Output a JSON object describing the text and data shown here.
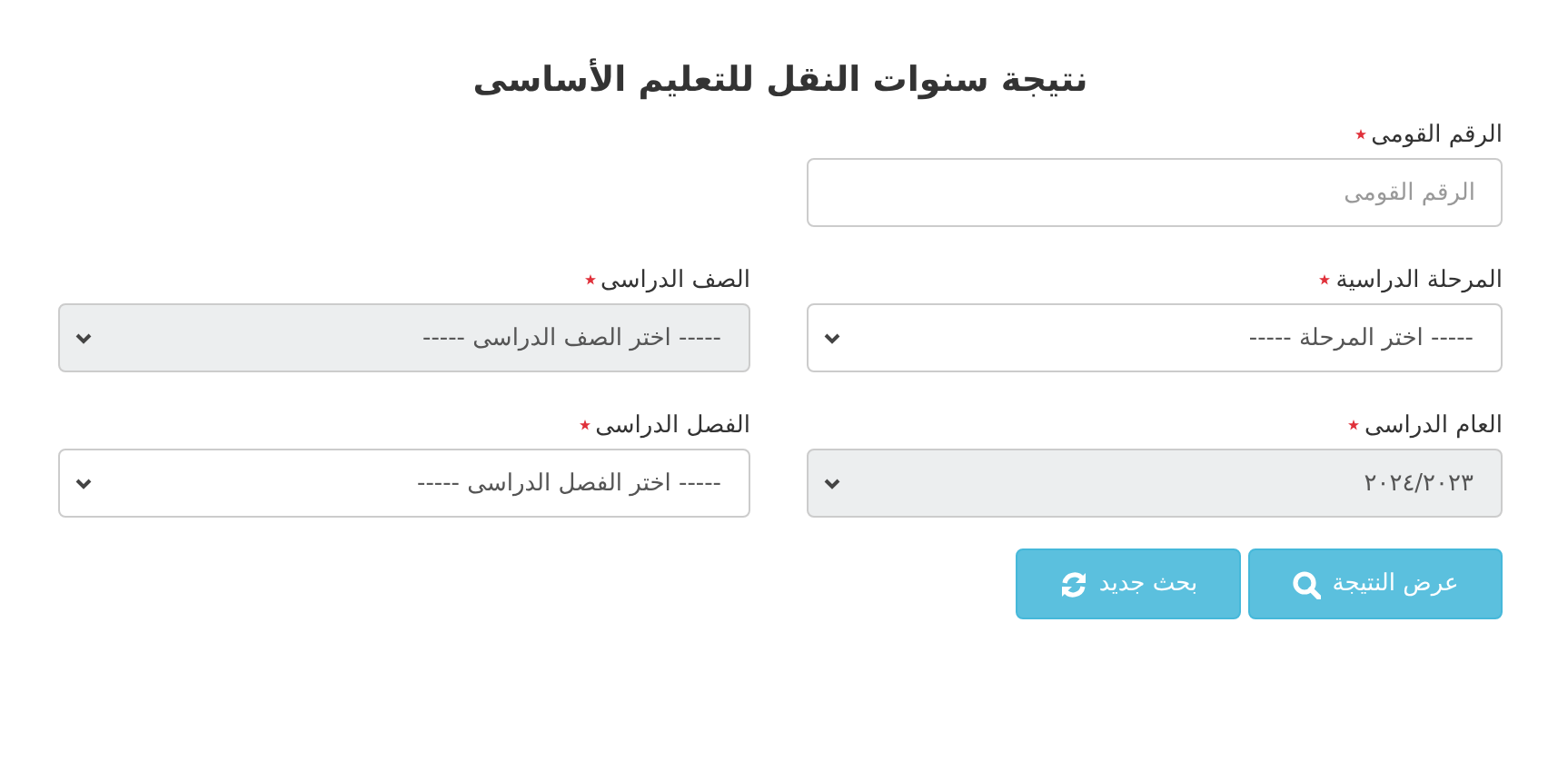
{
  "title": "نتيجة سنوات النقل للتعليم الأساسى",
  "rows": [
    [
      {
        "kind": "text",
        "label": "الرقم القومى",
        "required": true,
        "placeholder": "الرقم القومى",
        "disabled": false
      }
    ],
    [
      {
        "kind": "select",
        "label": "المرحلة الدراسية",
        "required": true,
        "value": "----- اختر المرحلة -----",
        "disabled": false
      },
      {
        "kind": "select",
        "label": "الصف الدراسى",
        "required": true,
        "value": "----- اختر الصف الدراسى -----",
        "disabled": true
      }
    ],
    [
      {
        "kind": "select",
        "label": "العام الدراسى",
        "required": true,
        "value": "٢٠٢٤/٢٠٢٣",
        "disabled": true
      },
      {
        "kind": "select",
        "label": "الفصل الدراسى",
        "required": true,
        "value": "----- اختر الفصل الدراسى -----",
        "disabled": false
      }
    ]
  ],
  "buttons": [
    {
      "label": "عرض النتيجة",
      "kind": "search"
    },
    {
      "label": "بحث جديد",
      "kind": "reset"
    }
  ]
}
